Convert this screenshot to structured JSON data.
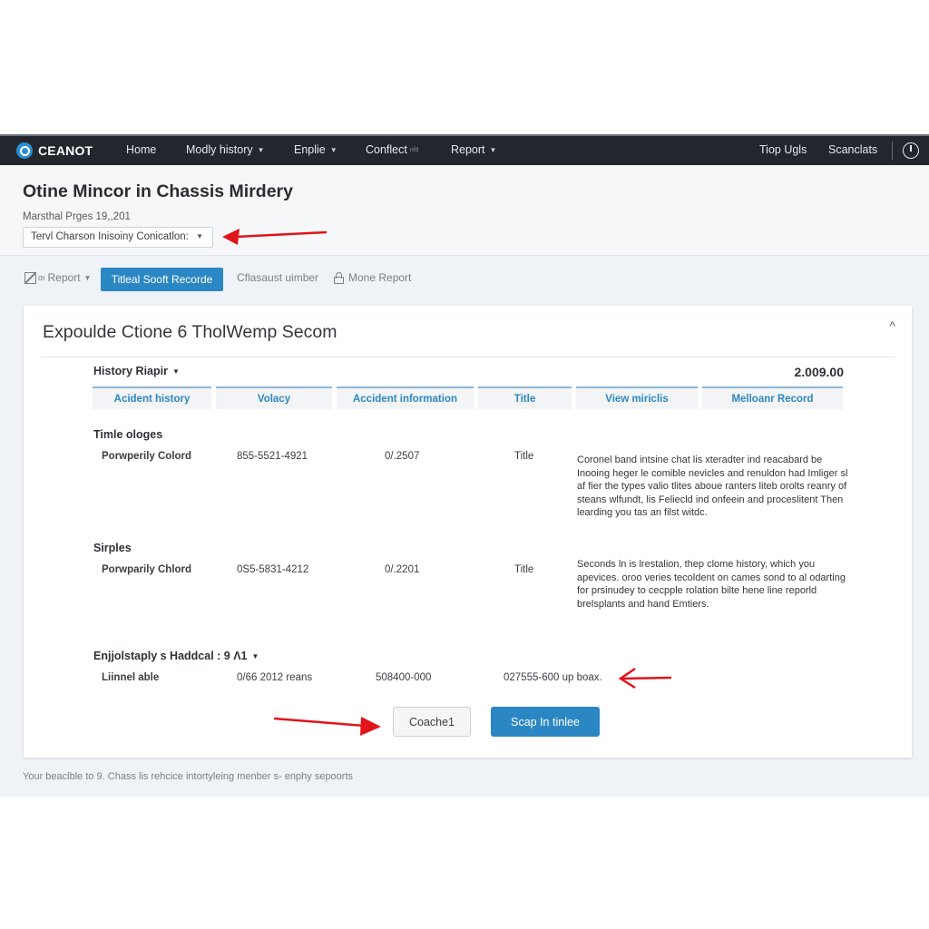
{
  "navbar": {
    "brand": "CEANOT",
    "items": [
      {
        "label": "Home",
        "has_caret": false
      },
      {
        "label": "Modly history",
        "has_caret": true
      },
      {
        "label": "Enplie",
        "has_caret": true
      },
      {
        "label": "Conflect",
        "badge": "нfd",
        "has_caret": false
      },
      {
        "label": "Report",
        "has_caret": true
      }
    ],
    "right_items": [
      {
        "label": "Tiop Ugls"
      },
      {
        "label": "Scanclats"
      }
    ],
    "power_icon": "power-icon"
  },
  "header": {
    "title": "Otine Mincor in Chassis Mirdery",
    "meta": "Marsthal Prges 19,,201",
    "select_value": "Tervl Charson Inisoiny Conicatlon:"
  },
  "toolbar": {
    "report_dropdown": "Report",
    "active_button": "Titleal Sooft Recorde",
    "link_1": "Cflasaust uimber",
    "link_2": "Mone Report"
  },
  "card": {
    "title": "Expoulde Ctione 6 TholWemp Secom",
    "section_dropdown": "History Riapir",
    "total": "2.009.00",
    "columns": [
      "Acident history",
      "Volacy",
      "Accident information",
      "Title",
      "View miriclis",
      "Melloanr Record"
    ],
    "groups": [
      {
        "label": "Timle ologes",
        "name": "Porwperily Colord",
        "phone": "855-5521-4921",
        "code": "0/.2507",
        "title": "Title",
        "description": "Coronel band intsine chat lis xteradter ind reacabard be Inooing heger le comible nevicles and renuldon had Imliger sl af fier the types valio tlites aboue ranters liteb orolts reanry of steans wlfundt, lis Feliecld ind onfeein and proceslitent Then learding you tas an filst witdc."
      },
      {
        "label": "Sirples",
        "name": "Porwparily Chlord",
        "phone": "0S5-5831-4212",
        "code": "0/.2201",
        "title": "Title",
        "description": "Seconds ln is lrestalion, thep clome history, which you apevices. oroo veries tecoldent on cames sond to al odarting for prsinudey to cecpple rolation bilte hene line reporld brelsplants and hand Emtiers."
      }
    ],
    "extra_section": {
      "label": "Enjjolstaply s Haddcal : 9 Λ1",
      "name": "Liinnel able",
      "date": "0/66 2012 reans",
      "amount": "508400-000",
      "ref": "027555-600 up boax."
    },
    "cancel_button": "Coache1",
    "submit_button": "Scap In tinlee"
  },
  "footer": {
    "text": "Your beaclble to 9. Chass lis rehcice intortyleing menber s- enphy sepoorts"
  },
  "colors": {
    "navbar_bg": "#23272d",
    "accent_blue": "#2b87c4",
    "tab_text": "#2e87c0",
    "annotation_red": "#e0141b"
  }
}
